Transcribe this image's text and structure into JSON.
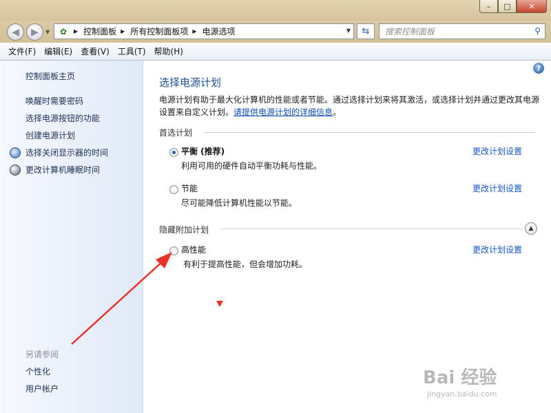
{
  "window": {
    "controls": {
      "minimize": "–",
      "maximize": "□",
      "close": "✕"
    }
  },
  "navigation": {
    "back_icon": "back-arrow-icon",
    "forward_icon": "forward-arrow-icon",
    "breadcrumb": [
      "控制面板",
      "所有控制面板项",
      "电源选项"
    ],
    "search_placeholder": "搜索控制面板"
  },
  "menu": [
    "文件(F)",
    "编辑(E)",
    "查看(V)",
    "工具(T)",
    "帮助(H)"
  ],
  "sidebar": {
    "home": "控制面板主页",
    "links": [
      "唤醒时需要密码",
      "选择电源按钮的功能",
      "创建电源计划",
      "选择关闭显示器的时间",
      "更改计算机睡眠时间"
    ],
    "see_also_heading": "另请参阅",
    "see_also": [
      "个性化",
      "用户帐户"
    ]
  },
  "main": {
    "help": "?",
    "title": "选择电源计划",
    "description": "电源计划有助于最大化计算机的性能或者节能。通过选择计划来将其激活，或选择计划并通过更改其电源设置来自定义计划。",
    "description_link": "请提供电源计划的详细信息",
    "description_end": "。",
    "preferred_heading": "首选计划",
    "hidden_heading": "隐藏附加计划",
    "plans": [
      {
        "name": "平衡 (推荐)",
        "desc": "利用可用的硬件自动平衡功耗与性能。",
        "link": "更改计划设置",
        "selected": true
      },
      {
        "name": "节能",
        "desc": "尽可能降低计算机性能以节能。",
        "link": "更改计划设置",
        "selected": false
      },
      {
        "name": "高性能",
        "desc": "有利于提高性能，但会增加功耗。",
        "link": "更改计划设置",
        "selected": false
      }
    ]
  },
  "watermark": {
    "text": "Bai 经验",
    "url": "jingyan.baidu.com"
  },
  "colors": {
    "accent": "#1f4e96",
    "link": "#1657c2",
    "annotation": "#e8322a"
  }
}
